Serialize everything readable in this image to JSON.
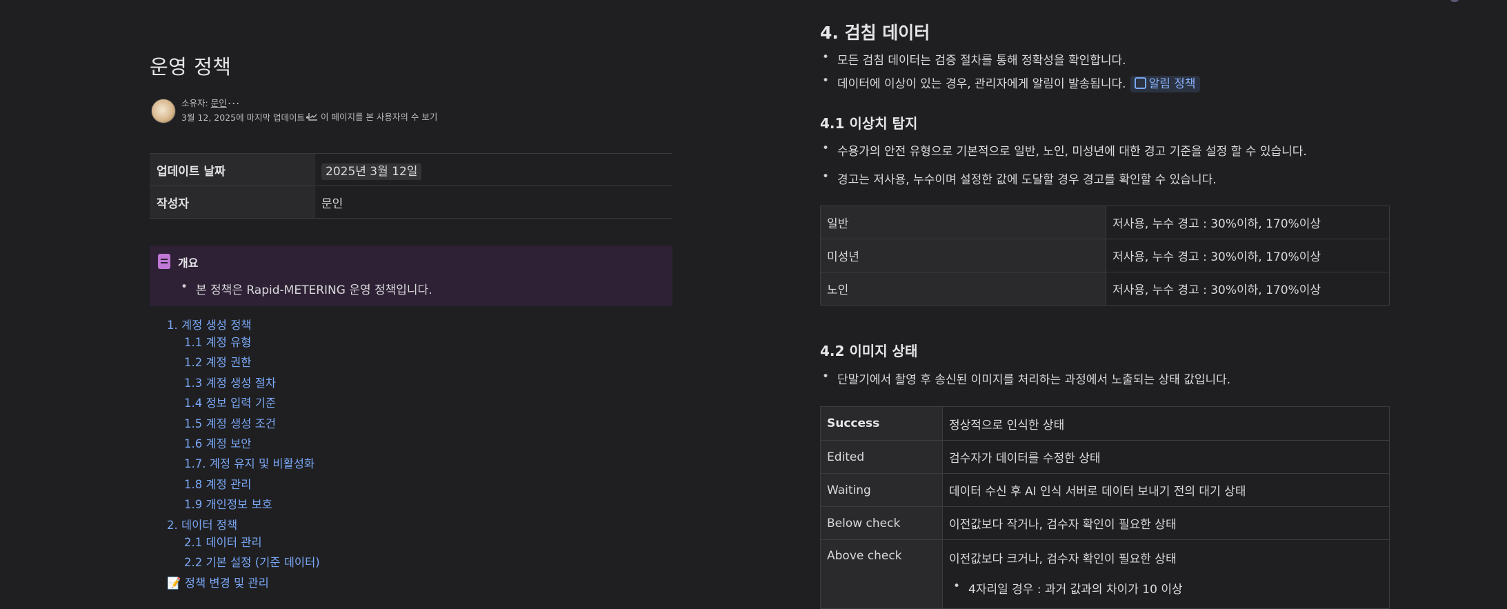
{
  "page": {
    "title": "운영 정책",
    "owner_prefix": "소유자: ",
    "owner_name": "문인",
    "more": "...",
    "updated": "3월 12, 2025에 마지막 업데이트•",
    "analytics": "이 페이지를 본 사용자의 수 보기"
  },
  "properties": [
    {
      "key": "업데이트 날짜",
      "value": "2025년 3월 12일"
    },
    {
      "key": "작성자",
      "value": "문인"
    }
  ],
  "summary": {
    "title": "개요",
    "bullet": "본 정책은 Rapid-METERING 운영 정책입니다."
  },
  "toc": [
    {
      "label": "1. 계정 생성 정책",
      "level": 1
    },
    {
      "label": "1.1 계정 유형",
      "level": 2
    },
    {
      "label": "1.2 계정 권한",
      "level": 2
    },
    {
      "label": "1.3 계정 생성 절차",
      "level": 2
    },
    {
      "label": "1.4 정보 입력 기준",
      "level": 2
    },
    {
      "label": "1.5 계정 생성 조건",
      "level": 2
    },
    {
      "label": "1.6 계정 보안",
      "level": 2
    },
    {
      "label": "1.7. 계정 유지 및 비활성화",
      "level": 2
    },
    {
      "label": "1.8 계정 관리",
      "level": 2
    },
    {
      "label": "1.9 개인정보 보호",
      "level": 2
    },
    {
      "label": "2. 데이터 정책",
      "level": 1
    },
    {
      "label": "2.1 데이터 관리",
      "level": 2
    },
    {
      "label": "2.2 기본 설정 (기준 데이터)",
      "level": 2
    },
    {
      "label": "📝 정책 변경 및 관리",
      "level": 1
    }
  ],
  "section4": {
    "title": "4. 검침 데이터",
    "bullet1": "모든 검침 데이터는 검증 절차를 통해 정확성을 확인합니다.",
    "bullet2": "데이터에 이상이 있는 경우, 관리자에게 알림이 발송됩니다.",
    "badge": "알림 정책"
  },
  "section41": {
    "title": "4.1 이상치 탐지",
    "bullet1": "수용가의 안전 유형으로 기본적으로 일반, 노인, 미성년에 대한 경고 기준을 설정 할 수 있습니다.",
    "bullet2": "경고는 저사용, 누수이며 설정한 값에 도달할 경우 경고를 확인할 수 있습니다.",
    "table": [
      {
        "k": "일반",
        "v": "저사용, 누수 경고 : 30%이하, 170%이상"
      },
      {
        "k": "미성년",
        "v": "저사용, 누수 경고 : 30%이하, 170%이상"
      },
      {
        "k": "노인",
        "v": "저사용, 누수 경고 : 30%이하, 170%이상"
      }
    ]
  },
  "section42": {
    "title": "4.2 이미지 상태",
    "bullet1": "단말기에서 촬영 후 송신된 이미지를 처리하는 과정에서 노출되는 상태 값입니다.",
    "table": [
      {
        "k": "Success",
        "v": "정상적으로 인식한 상태"
      },
      {
        "k": "Edited",
        "v": "검수자가 데이터를 수정한 상태"
      },
      {
        "k": "Waiting",
        "v": "데이터 수신 후 AI 인식 서버로 데이터 보내기 전의 대기 상태"
      },
      {
        "k": "Below check",
        "v": "이전값보다 작거나, 검수자 확인이 필요한 상태"
      },
      {
        "k": "Above check",
        "v": "이전값보다 크거나, 검수자 확인이 필요한 상태",
        "sub": "4자리일 경우 : 과거 값과의 차이가 10 이상"
      }
    ]
  }
}
